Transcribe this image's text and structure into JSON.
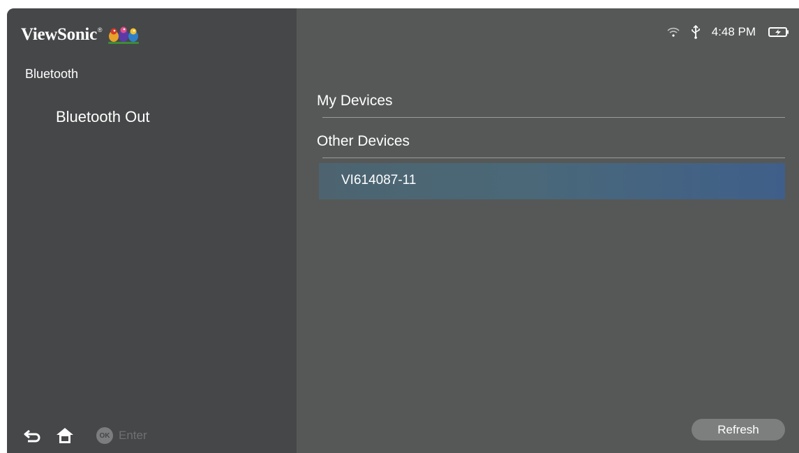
{
  "brand": {
    "name": "ViewSonic",
    "tm": "®"
  },
  "sidebar": {
    "section_title": "Bluetooth",
    "selected_item": "Bluetooth Out"
  },
  "bottom_bar": {
    "back_icon": "back-arrow-icon",
    "home_icon": "home-icon",
    "ok_badge": "OK",
    "enter_label": "Enter"
  },
  "status": {
    "wifi_icon": "wifi-icon",
    "usb_icon": "usb-icon",
    "time": "4:48 PM",
    "battery_icon": "battery-charging-icon"
  },
  "main": {
    "my_devices": "My Devices",
    "other_devices": "Other Devices",
    "devices": [
      {
        "name": "VI614087-11"
      }
    ],
    "refresh_label": "Refresh"
  },
  "colors": {
    "sidebar_bg": "#464748",
    "main_bg": "#565857",
    "highlight": "#3f5f8a",
    "button_bg": "#7d7f7e"
  }
}
